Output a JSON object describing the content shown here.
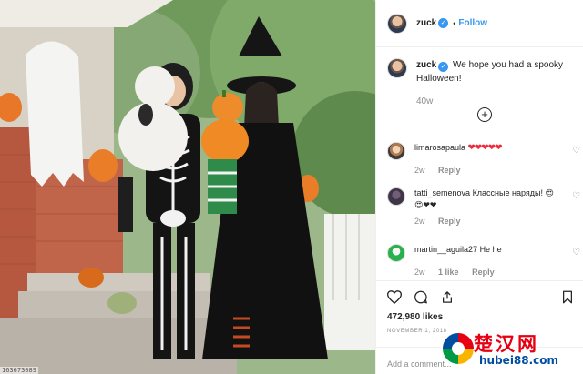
{
  "photo": {
    "alt_id": "163673089",
    "icon": "halloween-family-photo"
  },
  "header": {
    "username": "zuck",
    "separator": "•",
    "follow_label": "Follow"
  },
  "caption": {
    "username": "zuck",
    "text": "We hope you had a spooky Halloween!",
    "age": "40w"
  },
  "load_more": {
    "icon": "plus-circle-icon"
  },
  "comments": [
    {
      "username": "limarosapaula",
      "text": "❤❤❤❤❤",
      "age": "2w",
      "likes": "",
      "reply_label": "Reply"
    },
    {
      "username": "tatti_semenova",
      "text": "Классные наряды! 😍😍❤❤",
      "age": "2w",
      "likes": "",
      "reply_label": "Reply"
    },
    {
      "username": "martin__aguila27",
      "text": "He he",
      "age": "2w",
      "likes": "1 like",
      "reply_label": "Reply"
    }
  ],
  "actions": {
    "likes": "472,980 likes",
    "date": "November 1, 2018",
    "add_comment_placeholder": "Add a comment..."
  },
  "watermark": {
    "cn_text": "楚汉网",
    "url": "hubei88.com"
  },
  "colors": {
    "accent": "#3897f0",
    "heart": "#ed2b3a",
    "muted": "#8e8e8e",
    "watermark_red": "#e60012",
    "watermark_blue": "#004ea2"
  }
}
